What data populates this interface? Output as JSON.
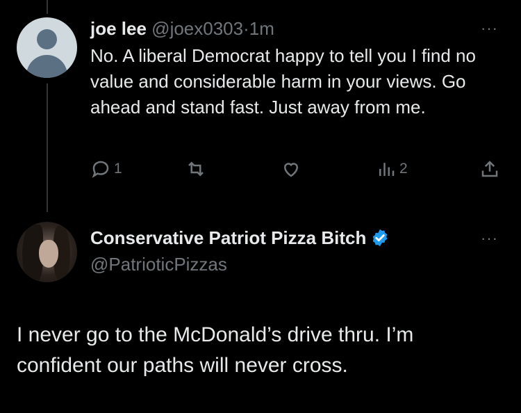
{
  "reply": {
    "name": "joe lee",
    "handle": "@joex0303",
    "separator": "·",
    "time": "1m",
    "text": "No. A liberal Democrat happy to tell you I find no value and considerable harm in your views. Go ahead and stand fast. Just away from me.",
    "more": "···",
    "actions": {
      "replies": "1",
      "retweets": "",
      "likes": "",
      "views": "2"
    }
  },
  "main_tweet": {
    "name": "Conservative Patriot Pizza Bitch",
    "handle": "@PatrioticPizzas",
    "more": "···",
    "text": "I never go to the McDonald’s drive thru. I’m confident our paths will never cross."
  },
  "colors": {
    "background": "#000000",
    "text": "#e7e9ea",
    "muted": "#71767b",
    "verified": "#1d9bf0"
  }
}
